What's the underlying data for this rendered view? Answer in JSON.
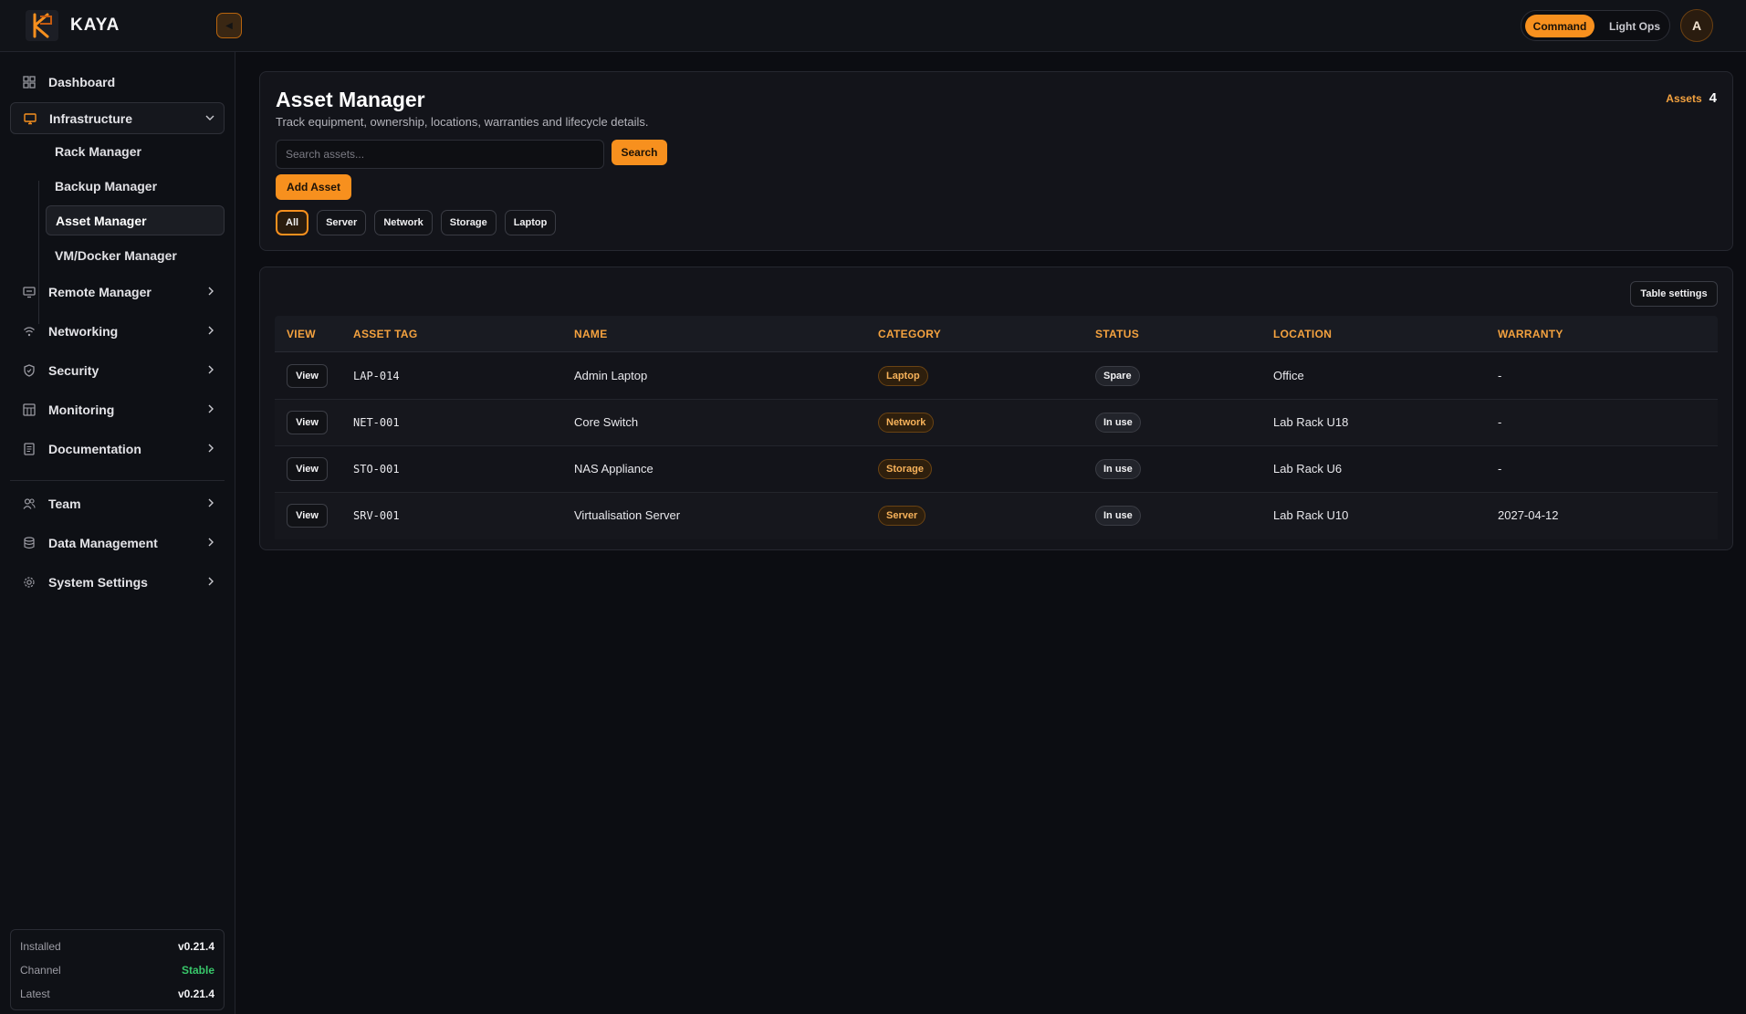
{
  "app": {
    "brand": "KAYA"
  },
  "topbar": {
    "mode_command": "Command",
    "mode_light": "Light Ops",
    "avatar_initial": "A"
  },
  "sidebar": {
    "items": [
      {
        "label": "Dashboard"
      },
      {
        "label": "Infrastructure"
      },
      {
        "label": "Remote Manager"
      },
      {
        "label": "Networking"
      },
      {
        "label": "Security"
      },
      {
        "label": "Monitoring"
      },
      {
        "label": "Documentation"
      },
      {
        "label": "Team"
      },
      {
        "label": "Data Management"
      },
      {
        "label": "System Settings"
      }
    ],
    "sub_items": [
      {
        "label": "Rack Manager"
      },
      {
        "label": "Backup Manager"
      },
      {
        "label": "Asset Manager"
      },
      {
        "label": "VM/Docker Manager"
      }
    ],
    "version": {
      "installed_label": "Installed",
      "installed_value": "v0.21.4",
      "channel_label": "Channel",
      "channel_value": "Stable",
      "latest_label": "Latest",
      "latest_value": "v0.21.4"
    }
  },
  "header": {
    "title": "Asset Manager",
    "subtitle": "Track equipment, ownership, locations, warranties and lifecycle details.",
    "assets_label": "Assets",
    "assets_count": "4",
    "search_placeholder": "Search assets...",
    "search_label": "Search",
    "add_label": "Add Asset",
    "filters": [
      "All",
      "Server",
      "Network",
      "Storage",
      "Laptop"
    ]
  },
  "table": {
    "settings_label": "Table settings",
    "columns": [
      "VIEW",
      "ASSET TAG",
      "NAME",
      "CATEGORY",
      "STATUS",
      "LOCATION",
      "WARRANTY"
    ],
    "view_label": "View",
    "rows": [
      {
        "tag": "LAP-014",
        "name": "Admin Laptop",
        "category": "Laptop",
        "status": "Spare",
        "location": "Office",
        "warranty": "-"
      },
      {
        "tag": "NET-001",
        "name": "Core Switch",
        "category": "Network",
        "status": "In use",
        "location": "Lab Rack U18",
        "warranty": "-"
      },
      {
        "tag": "STO-001",
        "name": "NAS Appliance",
        "category": "Storage",
        "status": "In use",
        "location": "Lab Rack U6",
        "warranty": "-"
      },
      {
        "tag": "SRV-001",
        "name": "Virtualisation Server",
        "category": "Server",
        "status": "In use",
        "location": "Lab Rack U10",
        "warranty": "2027-04-12"
      }
    ]
  },
  "colors": {
    "accent": "#f7901e",
    "accent_text": "#f4a23f",
    "status_green": "#38c76a",
    "background": "#0c0d12"
  }
}
